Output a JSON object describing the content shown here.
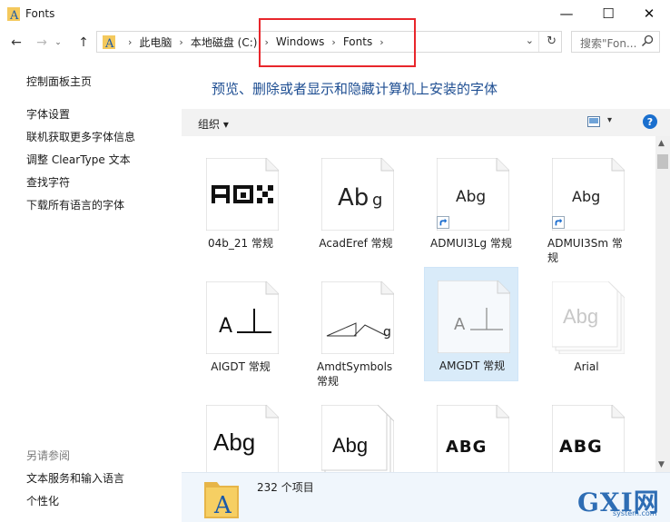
{
  "window": {
    "title": "Fonts",
    "controls": {
      "minimize": "—",
      "maximize": "☐",
      "close": "✕"
    }
  },
  "nav": {
    "back": "←",
    "forward": "→",
    "history": "⌄",
    "up": "↑"
  },
  "address": {
    "breadcrumbs": [
      "此电脑",
      "本地磁盘 (C:)",
      "Windows",
      "Fonts"
    ],
    "separator": "›",
    "dropdown": "⌄",
    "refresh": "↻"
  },
  "search": {
    "placeholder": "搜索\"Fon..."
  },
  "sidebar": {
    "home": "控制面板主页",
    "links": [
      "字体设置",
      "联机获取更多字体信息",
      "调整 ClearType 文本",
      "查找字符",
      "下载所有语言的字体"
    ],
    "see_also_heading": "另请参阅",
    "see_also": [
      "文本服务和输入语言",
      "个性化"
    ]
  },
  "main": {
    "heading": "预览、删除或者显示和隐藏计算机上安装的字体",
    "toolbar": {
      "organize": "组织 ▾",
      "view_dropdown": "▾",
      "help": "?"
    }
  },
  "fonts": [
    {
      "name": "04b_21 常规",
      "sample": "AHH",
      "shortcut": false,
      "selected": false,
      "faded": false
    },
    {
      "name": "AcadEref 常规",
      "sample": "Abg",
      "shortcut": false,
      "selected": false,
      "faded": false
    },
    {
      "name": "ADMUI3Lg 常规",
      "sample": "Abg",
      "shortcut": true,
      "selected": false,
      "faded": false
    },
    {
      "name": "ADMUI3Sm 常规",
      "sample": "Abg",
      "shortcut": true,
      "selected": false,
      "faded": false
    },
    {
      "name": "AIGDT 常规",
      "sample": "A⊥",
      "shortcut": false,
      "selected": false,
      "faded": false
    },
    {
      "name": "AmdtSymbols 常规",
      "sample": "g",
      "shortcut": false,
      "selected": false,
      "faded": false
    },
    {
      "name": "AMGDT 常规",
      "sample": "A⊥",
      "shortcut": false,
      "selected": true,
      "faded": false
    },
    {
      "name": "Arial",
      "sample": "Abg",
      "shortcut": false,
      "selected": false,
      "faded": true
    },
    {
      "name": "",
      "sample": "Abg",
      "shortcut": false,
      "selected": false,
      "faded": false
    },
    {
      "name": "",
      "sample": "Abg",
      "shortcut": false,
      "selected": false,
      "faded": false,
      "stacked": true
    },
    {
      "name": "",
      "sample": "ABG",
      "shortcut": false,
      "selected": false,
      "faded": false
    },
    {
      "name": "",
      "sample": "ABG",
      "shortcut": false,
      "selected": false,
      "faded": false
    }
  ],
  "details": {
    "count": "232 个项目"
  },
  "scrollbar": {
    "up": "▲",
    "down": "▼"
  },
  "watermark": {
    "text": "GXI网",
    "sub": "system.com"
  },
  "colors": {
    "heading": "#1e4e92",
    "highlight": "#e8262b",
    "selection": "#d9ebf9",
    "details_bg": "#f0f6fc"
  }
}
